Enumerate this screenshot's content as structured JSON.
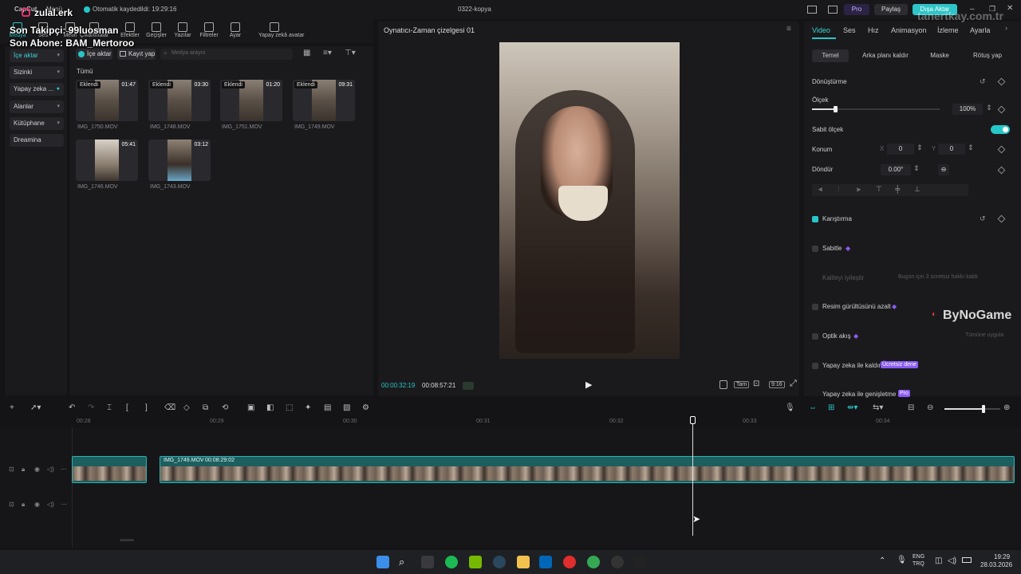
{
  "overlay": {
    "instagram": "zulal.erk",
    "follower": "Son Takipçi: 99luosman",
    "subscriber": "Son Abone: BAM_Mertoroo",
    "watermark_right": "ByNoGame",
    "watermark_top": "tanertkay.com.tr"
  },
  "titlebar": {
    "app_name": "CapCut",
    "menu": "Menü",
    "autosave": "Otomatik kaydedildi: 19:29:16",
    "project": "0322-kopya",
    "pro": "Pro",
    "share": "Paylaş",
    "export": "Dışa Aktar"
  },
  "media_tools": [
    {
      "label": "Medya"
    },
    {
      "label": "Ses"
    },
    {
      "label": "Metin"
    },
    {
      "label": "Çıkartmalar"
    },
    {
      "label": "Efektler"
    },
    {
      "label": "Geçişler"
    },
    {
      "label": "Yazılar"
    },
    {
      "label": "Filtreler"
    },
    {
      "label": "Ayar"
    },
    {
      "label": "Yapay zekâ avatar"
    }
  ],
  "leftnav": [
    {
      "label": "İçe aktar"
    },
    {
      "label": "Sizinki"
    },
    {
      "label": "Yapay zeka ..."
    },
    {
      "label": "Alanlar"
    },
    {
      "label": "Kütüphane"
    },
    {
      "label": "Dreamina"
    }
  ],
  "media": {
    "import_btn": "İçe aktar",
    "record_btn": "Kayıt yap",
    "search_placeholder": "Medya arayın",
    "filter_all": "Tümü",
    "items": [
      {
        "badge": "Eklendi",
        "dur": "01:47",
        "name": "IMG_1750.MOV"
      },
      {
        "badge": "Eklendi",
        "dur": "03:30",
        "name": "IMG_1748.MOV"
      },
      {
        "badge": "Eklendi",
        "dur": "01:20",
        "name": "IMG_1751.MOV"
      },
      {
        "badge": "Eklendi",
        "dur": "09:31",
        "name": "IMG_1749.MOV"
      },
      {
        "badge": "",
        "dur": "05:41",
        "name": "IMG_1746.MOV"
      },
      {
        "badge": "",
        "dur": "03:12",
        "name": "IMG_1743.MOV"
      }
    ]
  },
  "player": {
    "title": "Oynatıcı-Zaman çizelgesi 01",
    "current": "00:00:32:19",
    "total": "00:08:57:21",
    "full_label": "Tam",
    "ratio": "9:16"
  },
  "props": {
    "tabs": [
      "Video",
      "Ses",
      "Hız",
      "Animasyon",
      "İzleme",
      "Ayarla"
    ],
    "subtabs": [
      "Temel",
      "Arka planı kaldır",
      "Maske",
      "Rötuş yap"
    ],
    "transform": "Dönüştürme",
    "scale": "Ölçek",
    "scale_value": "100%",
    "scale_fraction": 0.18,
    "uniform_scale": "Sabit ölçek",
    "position": "Konum",
    "pos_x_label": "X",
    "pos_x": "0",
    "pos_y_label": "Y",
    "pos_y": "0",
    "rotate": "Döndür",
    "rotate_value": "0.00°",
    "blend": "Karıştırma",
    "stabilize": "Sabitle",
    "enhance": "Kaliteyi iyileştir",
    "enhance_note": "Bugün için 3 ücretsiz hakkı kaldı",
    "denoise": "Resim gürültüsünü azalt",
    "optical": "Optik akış",
    "optical_note": "Tümüne uygula",
    "ai_remove": "Yapay zeka ile kaldır",
    "ai_remove_badge": "Ücretsiz dene",
    "ai_expand": "Yapay zeka ile genişletme",
    "ai_expand_badge": "Pro"
  },
  "timeline": {
    "ticks": [
      "00:28",
      "00:29",
      "00:30",
      "00:31",
      "00:32",
      "00:33",
      "00:34"
    ],
    "clip_name": "IMG_1749.MOV",
    "clip_dur": "00:08:29:02",
    "zoom_fraction": 0.7
  },
  "taskbar": {
    "lang1": "ENG",
    "lang2": "TRQ",
    "time": "19:29",
    "date": "28.03.2026"
  },
  "colors": {
    "accent": "#27c6c9",
    "export": "#2fc4c7",
    "pro": "#8a5cf6"
  }
}
